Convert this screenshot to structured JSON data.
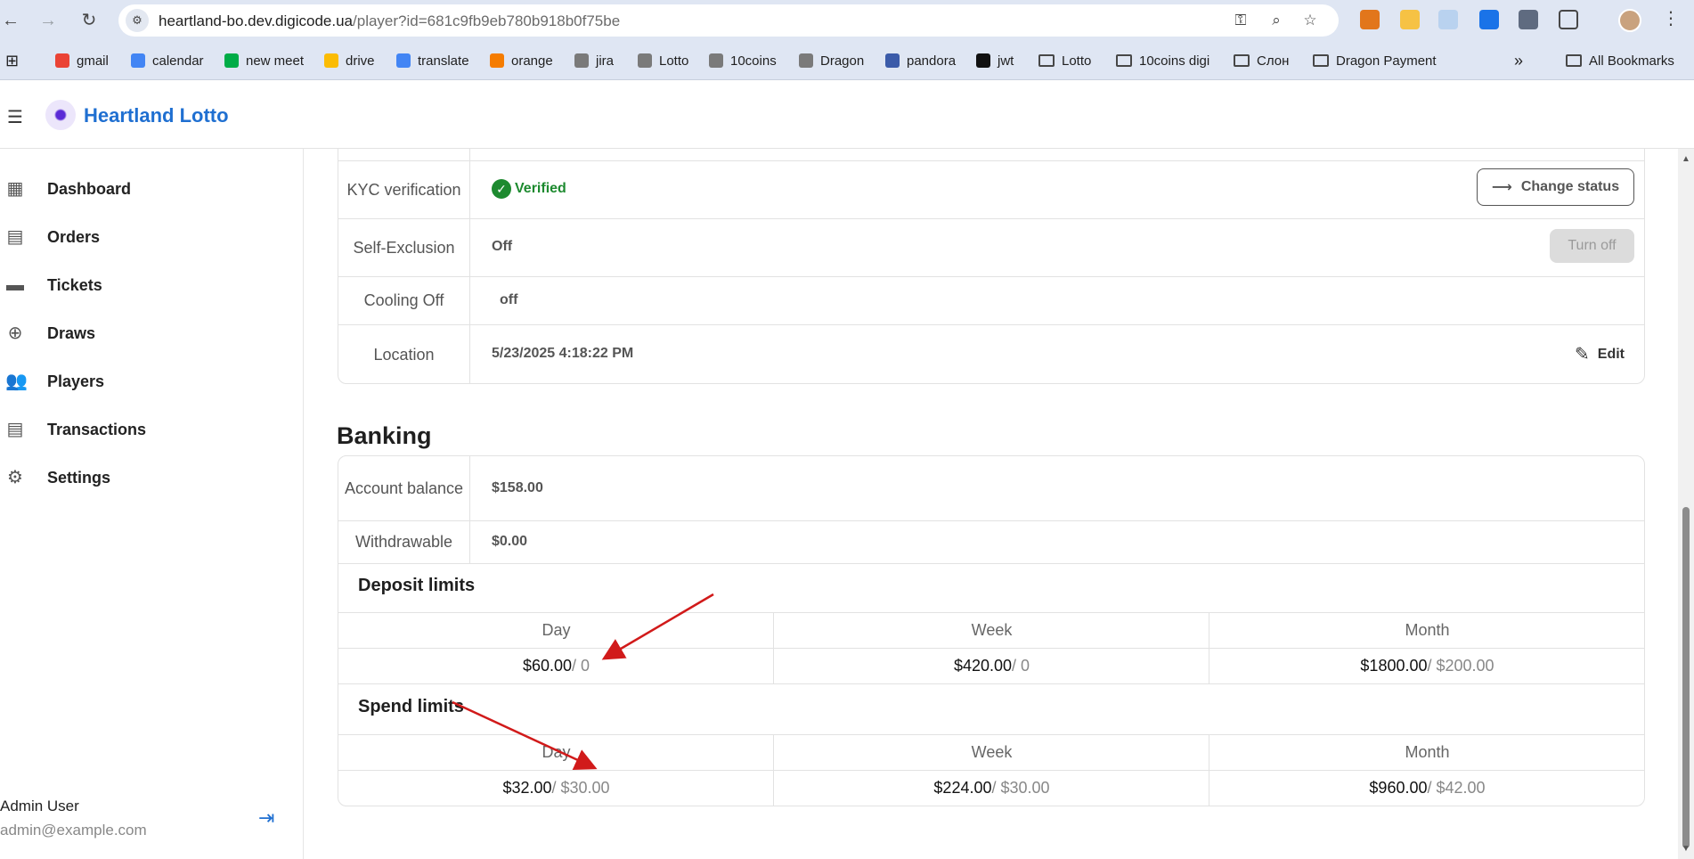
{
  "browser": {
    "url_host": "heartland-bo.dev.digicode.ua",
    "url_path": "/player?id=681c9fb9eb780b918b0f75be",
    "bookmarks": [
      {
        "label": "gmail",
        "color": "#ea4335"
      },
      {
        "label": "calendar",
        "color": "#4285f4"
      },
      {
        "label": "new meet",
        "color": "#00ac47"
      },
      {
        "label": "drive",
        "color": "#fbbc04"
      },
      {
        "label": "translate",
        "color": "#4285f4"
      },
      {
        "label": "orange",
        "color": "#f57c00"
      },
      {
        "label": "jira",
        "color": "#7a7a7a"
      },
      {
        "label": "Lotto",
        "color": "#7a7a7a"
      },
      {
        "label": "10coins",
        "color": "#7a7a7a"
      },
      {
        "label": "Dragon",
        "color": "#7a7a7a"
      },
      {
        "label": "pandora",
        "color": "#3b5ba9"
      },
      {
        "label": "jwt",
        "color": "#111111"
      }
    ],
    "folders": [
      "Lotto",
      "10coins digi",
      "Слон",
      "Dragon Payment"
    ],
    "more": "»",
    "all_bookmarks": "All Bookmarks"
  },
  "app": {
    "brand": "Heartland Lotto",
    "accent": "#1f6fd1"
  },
  "sidebar": {
    "items": [
      {
        "label": "Dashboard",
        "icon": "dashboard-icon"
      },
      {
        "label": "Orders",
        "icon": "orders-icon"
      },
      {
        "label": "Tickets",
        "icon": "ticket-icon"
      },
      {
        "label": "Draws",
        "icon": "gamepad-icon"
      },
      {
        "label": "Players",
        "icon": "people-icon"
      },
      {
        "label": "Transactions",
        "icon": "list-icon"
      },
      {
        "label": "Settings",
        "icon": "gear-icon"
      }
    ],
    "user_name": "Admin User",
    "user_email": "admin@example.com"
  },
  "player": {
    "kyc": {
      "label": "KYC verification",
      "value": "Verified",
      "button": "Change status"
    },
    "self_exclusion": {
      "label": "Self-Exclusion",
      "value": "Off",
      "button": "Turn off"
    },
    "cooling_off": {
      "label": "Cooling Off",
      "value": "off"
    },
    "location": {
      "label": "Location",
      "value": "5/23/2025 4:18:22 PM",
      "button": "Edit"
    }
  },
  "banking": {
    "title": "Banking",
    "account_balance": {
      "label": "Account balance",
      "value": "$158.00"
    },
    "withdrawable": {
      "label": "Withdrawable",
      "value": "$0.00"
    },
    "deposit_limits": {
      "title": "Deposit limits",
      "columns": [
        "Day",
        "Week",
        "Month"
      ],
      "values": [
        {
          "current": "$60.00",
          "max": " / 0"
        },
        {
          "current": "$420.00",
          "max": " / 0"
        },
        {
          "current": "$1800.00",
          "max": " / $200.00"
        }
      ]
    },
    "spend_limits": {
      "title": "Spend limits",
      "columns": [
        "Day",
        "Week",
        "Month"
      ],
      "values": [
        {
          "current": "$32.00",
          "max": " / $30.00"
        },
        {
          "current": "$224.00",
          "max": " / $30.00"
        },
        {
          "current": "$960.00",
          "max": " / $42.00"
        }
      ]
    }
  },
  "annotation_color": "#d11a1a"
}
